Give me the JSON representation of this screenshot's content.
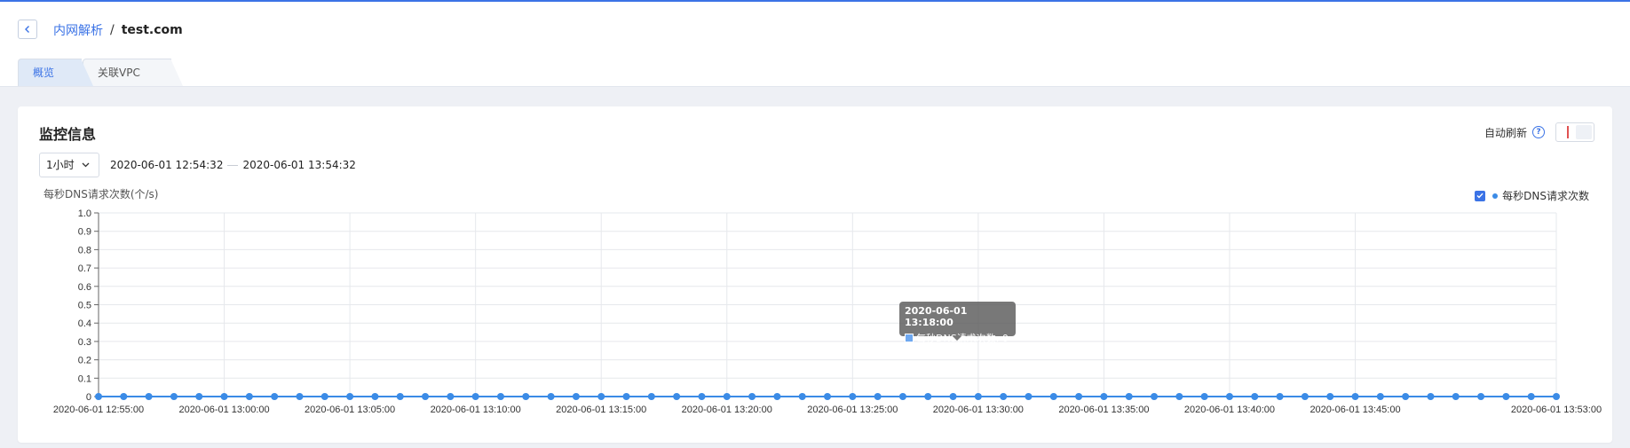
{
  "breadcrumb": {
    "parent": "内网解析",
    "separator": "/",
    "current": "test.com"
  },
  "tabs": [
    {
      "label": "概览",
      "active": true
    },
    {
      "label": "关联VPC",
      "active": false
    }
  ],
  "monitor": {
    "title": "监控信息",
    "auto_refresh_label": "自动刷新",
    "help_glyph": "?",
    "range_select": "1小时",
    "start_time": "2020-06-01 12:54:32",
    "end_time": "2020-06-01 13:54:32"
  },
  "chart_data": {
    "type": "line",
    "title": "",
    "ylabel": "每秒DNS请求次数(个/s)",
    "xlabel": "",
    "ylim": [
      0,
      1
    ],
    "y_ticks": [
      "0",
      "0.1",
      "0.2",
      "0.3",
      "0.4",
      "0.5",
      "0.6",
      "0.7",
      "0.8",
      "0.9",
      "1.0"
    ],
    "x_tick_labels": [
      "2020-06-01 12:55:00",
      "2020-06-01 13:00:00",
      "2020-06-01 13:05:00",
      "2020-06-01 13:10:00",
      "2020-06-01 13:15:00",
      "2020-06-01 13:20:00",
      "2020-06-01 13:25:00",
      "2020-06-01 13:30:00",
      "2020-06-01 13:35:00",
      "2020-06-01 13:40:00",
      "2020-06-01 13:45:00",
      "2020-06-01 13:53:00"
    ],
    "x_start": "2020-06-01 12:55:00",
    "x_end": "2020-06-01 13:53:00",
    "x_interval_minutes": 1,
    "series": [
      {
        "name": "每秒DNS请求次数",
        "color": "#3b8be6",
        "values": [
          0,
          0,
          0,
          0,
          0,
          0,
          0,
          0,
          0,
          0,
          0,
          0,
          0,
          0,
          0,
          0,
          0,
          0,
          0,
          0,
          0,
          0,
          0,
          0,
          0,
          0,
          0,
          0,
          0,
          0,
          0,
          0,
          0,
          0,
          0,
          0,
          0,
          0,
          0,
          0,
          0,
          0,
          0,
          0,
          0,
          0,
          0,
          0,
          0,
          0,
          0,
          0,
          0,
          0,
          0,
          0,
          0,
          0,
          0
        ]
      }
    ],
    "legend": {
      "label": "每秒DNS请求次数",
      "checked": true,
      "position": "top-right"
    },
    "grid": true,
    "tooltip": {
      "time": "2020-06-01 13:18:00",
      "series_label": "每秒DNS请求次数",
      "value": "0"
    }
  }
}
